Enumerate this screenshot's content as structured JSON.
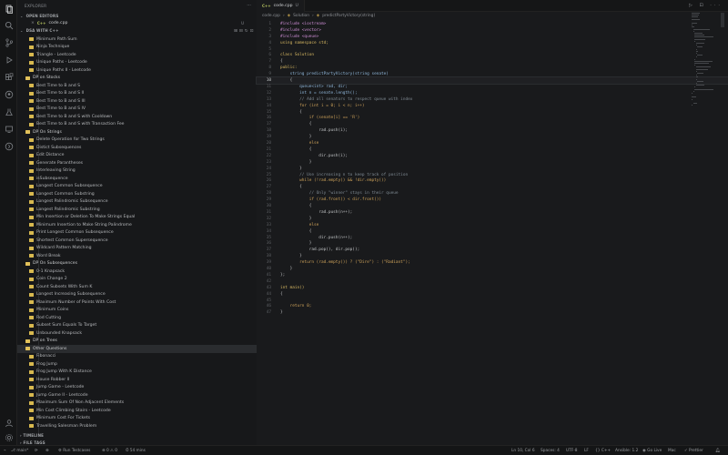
{
  "sidebar": {
    "title": "EXPLORER",
    "title_actions": "···",
    "open_editors_header": "OPEN EDITORS",
    "open_file": {
      "lang": "C++",
      "name": "code.cpp",
      "badge": "U"
    },
    "project_header": "DSA WITH C++",
    "tree": [
      {
        "label": "Minimum Path Sum",
        "type": "file",
        "level": 2
      },
      {
        "label": "Ninja Technique",
        "type": "file",
        "level": 2
      },
      {
        "label": "Triangle - Leetcode",
        "type": "file",
        "level": 2
      },
      {
        "label": "Unique Paths - Leetcode",
        "type": "file",
        "level": 2
      },
      {
        "label": "Unique Paths II - Leetcode",
        "type": "file",
        "level": 2
      },
      {
        "label": "DP on Stocks",
        "type": "folder",
        "level": 1
      },
      {
        "label": "Best Time to B and S",
        "type": "file",
        "level": 2
      },
      {
        "label": "Best Time to B and S II",
        "type": "file",
        "level": 2
      },
      {
        "label": "Best Time to B and S III",
        "type": "file",
        "level": 2
      },
      {
        "label": "Best Time to B and S IV",
        "type": "file",
        "level": 2
      },
      {
        "label": "Best Time to B and S with Cooldown",
        "type": "file",
        "level": 2
      },
      {
        "label": "Best Time to B and S with Transaction Fee",
        "type": "file",
        "level": 2
      },
      {
        "label": "DP On Strings",
        "type": "folder",
        "level": 1
      },
      {
        "label": "Delete Operation for Two Strings",
        "type": "file",
        "level": 2
      },
      {
        "label": "Distict Subsequences",
        "type": "file",
        "level": 2
      },
      {
        "label": "Edit Distance",
        "type": "file",
        "level": 2
      },
      {
        "label": "Generate Parantheses",
        "type": "file",
        "level": 2
      },
      {
        "label": "Interleaving String",
        "type": "file",
        "level": 2
      },
      {
        "label": "isSubsequence",
        "type": "file",
        "level": 2
      },
      {
        "label": "Longest Common Subsequence",
        "type": "file",
        "level": 2
      },
      {
        "label": "Longest Common Substring",
        "type": "file",
        "level": 2
      },
      {
        "label": "Longest Palindromic Subsequence",
        "type": "file",
        "level": 2
      },
      {
        "label": "Longest Palindromic Substring",
        "type": "file",
        "level": 2
      },
      {
        "label": "Min Insertion or Deletion To Make Strings Equal",
        "type": "file",
        "level": 2
      },
      {
        "label": "Minimum Insertion to Make String Palindrome",
        "type": "file",
        "level": 2
      },
      {
        "label": "Print Longest Common Subsequence",
        "type": "file",
        "level": 2
      },
      {
        "label": "Shortest Common Supersequence",
        "type": "file",
        "level": 2
      },
      {
        "label": "Wildcard Pattern Matching",
        "type": "file",
        "level": 2
      },
      {
        "label": "Word Break",
        "type": "file",
        "level": 2
      },
      {
        "label": "DP On Subsequences",
        "type": "folder",
        "level": 1
      },
      {
        "label": "0-1 Knapsack",
        "type": "file",
        "level": 2
      },
      {
        "label": "Coin Change 2",
        "type": "file",
        "level": 2
      },
      {
        "label": "Count Subsets With Sum K",
        "type": "file",
        "level": 2
      },
      {
        "label": "Longest Increasing Subsequence",
        "type": "file",
        "level": 2
      },
      {
        "label": "Maximum Number of Points With Cost",
        "type": "file",
        "level": 2
      },
      {
        "label": "Minimum Coins",
        "type": "file",
        "level": 2
      },
      {
        "label": "Rod Cutting",
        "type": "file",
        "level": 2
      },
      {
        "label": "Subset Sum Equals To Target",
        "type": "file",
        "level": 2
      },
      {
        "label": "Unbounded Knapsack",
        "type": "file",
        "level": 2
      },
      {
        "label": "DP on Trees",
        "type": "folder",
        "level": 1
      },
      {
        "label": "Other Questions",
        "type": "folder",
        "level": 1,
        "selected": true
      },
      {
        "label": "Fibonacci",
        "type": "file",
        "level": 2
      },
      {
        "label": "Frog Jump",
        "type": "file",
        "level": 2
      },
      {
        "label": "Frog Jump With K Distance",
        "type": "file",
        "level": 2
      },
      {
        "label": "House Robber II",
        "type": "file",
        "level": 2
      },
      {
        "label": "Jump Game - Leetcode",
        "type": "file",
        "level": 2
      },
      {
        "label": "Jump Game II - Leetcode",
        "type": "file",
        "level": 2
      },
      {
        "label": "Maximum Sum Of Non Adjacent Elements",
        "type": "file",
        "level": 2
      },
      {
        "label": "Min Cost Climbing Stairs - Leetcode",
        "type": "file",
        "level": 2
      },
      {
        "label": "Minimum Cost For Tickets",
        "type": "file",
        "level": 2
      },
      {
        "label": "Travelling Salesman Problem",
        "type": "file",
        "level": 2
      }
    ],
    "timeline_header": "TIMELINE",
    "filetags_header": "FILE TAGS"
  },
  "editor": {
    "tab": {
      "lang": "C++",
      "name": "code.cpp",
      "badge": "U"
    },
    "tab_actions": "▷ ⊡ ···",
    "breadcrumbs": [
      "code.cpp",
      "Solution",
      "predictPartyVictory(string)"
    ],
    "current_line": 10,
    "lines": [
      "#include <iostream>",
      "#include <vector>",
      "#include <queue>",
      "using namespace std;",
      "",
      "class Solution",
      "{",
      "public:",
      "    string predictPartyVictory(string senate)",
      "    {",
      "        queue<int> rad, dir;",
      "        int n = senate.length();",
      "        // Add all senators to respect queue with index",
      "        for (int i = 0; i < n; i++)",
      "        {",
      "            if (senate[i] == 'R')",
      "            {",
      "                rad.push(i);",
      "            }",
      "            else",
      "            {",
      "                dir.push(i);",
      "            }",
      "        }",
      "        // Use increasing n to keep track of position",
      "        while (!rad.empty() && !dir.empty())",
      "        {",
      "            // Only \"winner\" stays in their queue",
      "            if (rad.front() < dir.front())",
      "            {",
      "                rad.push(n++);",
      "            }",
      "            else",
      "            {",
      "                dir.push(n++);",
      "            }",
      "            rad.pop(), dir.pop();",
      "        }",
      "        return (rad.empty()) ? (\"Dire\") : (\"Radiant\");",
      "    }",
      "};",
      "",
      "int main()",
      "{",
      "",
      "    return 0;",
      "}"
    ]
  },
  "status": {
    "branch": "main*",
    "sync": "⟳",
    "debug": "⊗",
    "run": "Run Testcases",
    "problems": "⊗ 0 ⚠ 0",
    "time": "54 mins",
    "position": "Ln 10, Col 6",
    "spaces": "Spaces: 4",
    "encoding": "UTF-8",
    "eol": "LF",
    "lang": "{} C++",
    "ansifix": "Ansible: 1.2",
    "golive": "Go Live",
    "mac": "Mac",
    "prettier": "Prettier"
  }
}
